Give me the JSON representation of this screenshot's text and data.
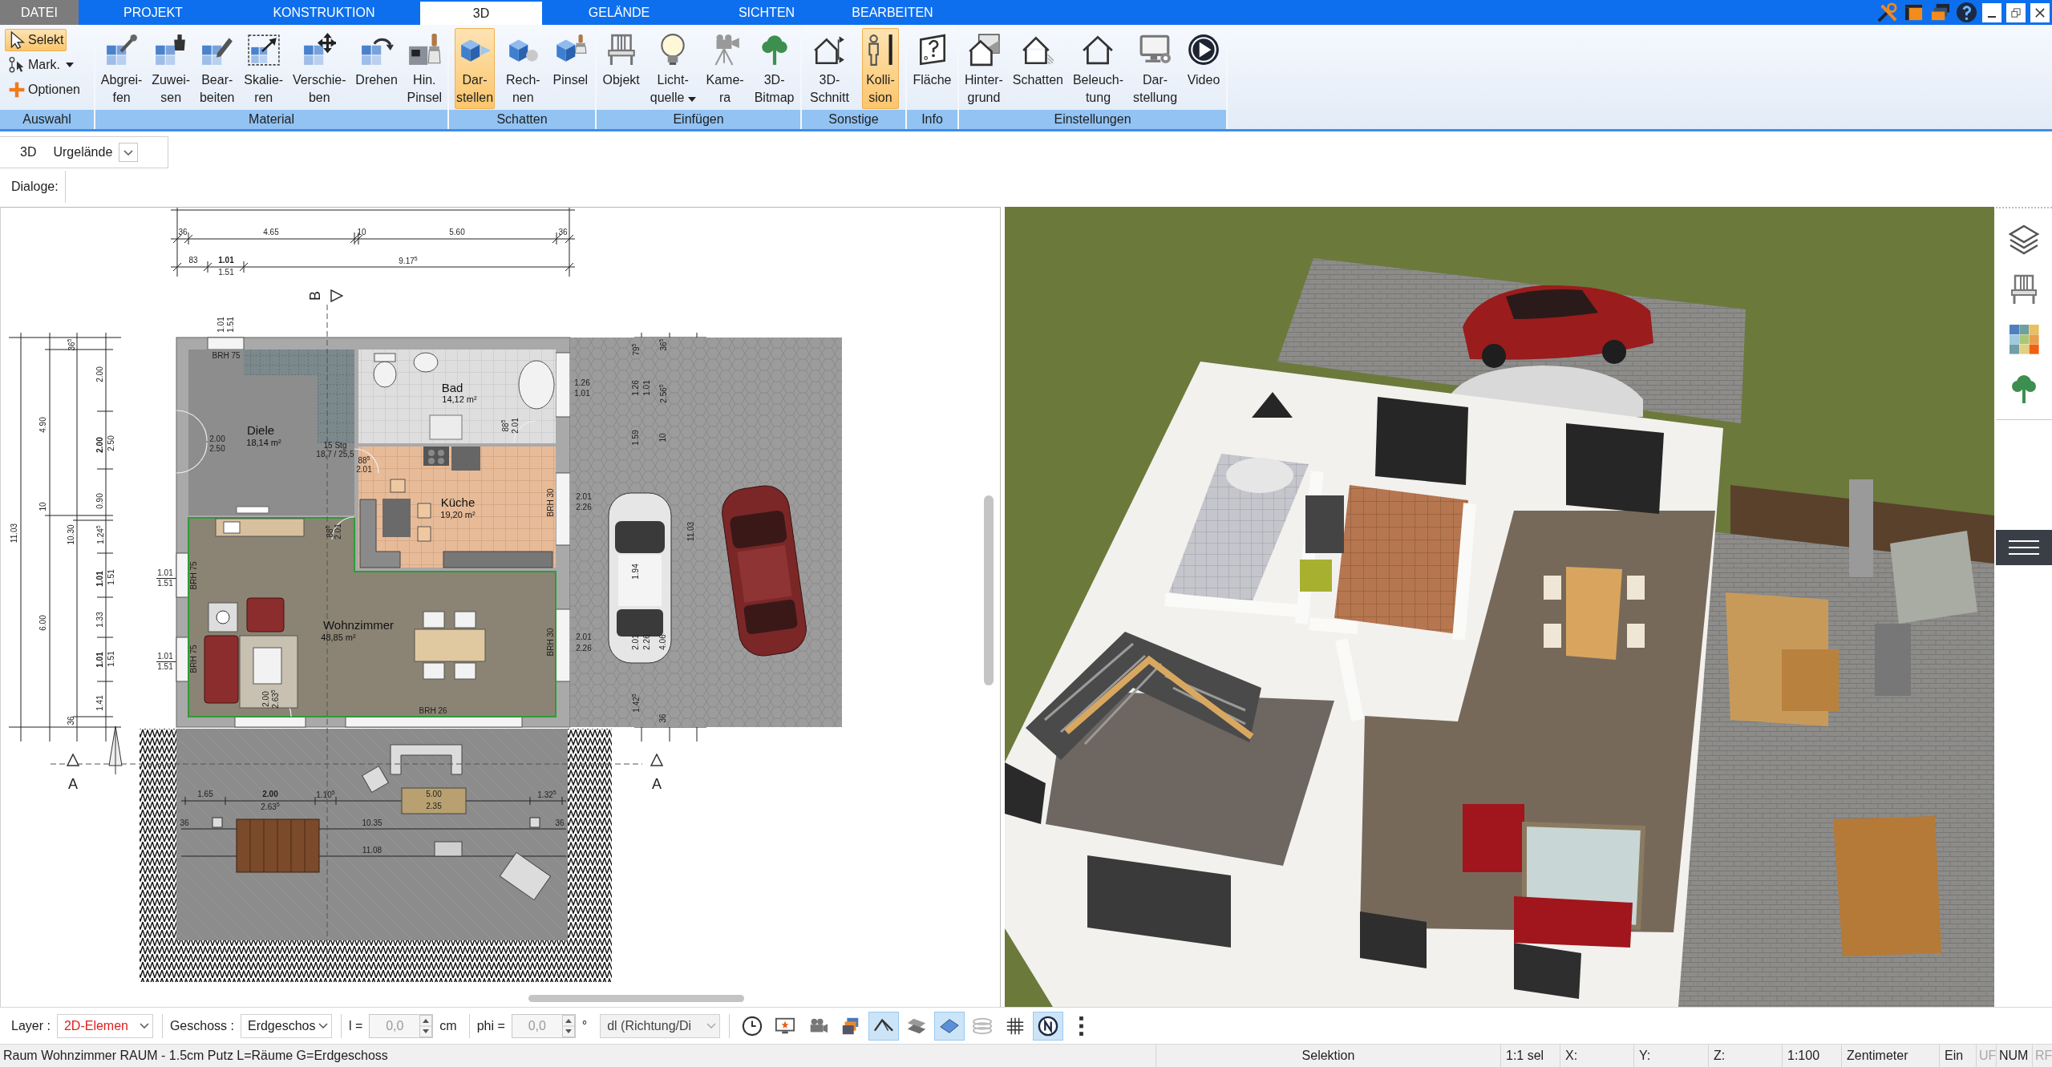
{
  "menu_tabs": [
    {
      "label": "DATEI",
      "kind": "file",
      "selected": false
    },
    {
      "label": "PROJEKT",
      "kind": "tab",
      "selected": false
    },
    {
      "label": "KONSTRUKTION",
      "kind": "tab",
      "selected": false
    },
    {
      "label": "3D",
      "kind": "tab",
      "selected": true
    },
    {
      "label": "GELÄNDE",
      "kind": "tab",
      "selected": false
    },
    {
      "label": "SICHTEN",
      "kind": "tab",
      "selected": false
    },
    {
      "label": "BEARBEITEN",
      "kind": "tab",
      "selected": false
    }
  ],
  "ribbon": {
    "groups": [
      {
        "label": "Auswahl",
        "items": [
          {
            "kind": "small",
            "lines": [
              "Selekt"
            ],
            "selected": true,
            "dropdown": false
          },
          {
            "kind": "small",
            "lines": [
              "Mark."
            ],
            "selected": false,
            "dropdown": true
          },
          {
            "kind": "small",
            "lines": [
              "Optionen"
            ],
            "selected": false,
            "dropdown": false
          }
        ]
      },
      {
        "label": "Material",
        "items": [
          {
            "kind": "large",
            "lines": [
              "Abgrei-",
              "fen"
            ],
            "selected": false,
            "dropdown": false
          },
          {
            "kind": "large",
            "lines": [
              "Zuwei-",
              "sen"
            ],
            "selected": false,
            "dropdown": false
          },
          {
            "kind": "large",
            "lines": [
              "Bear-",
              "beiten"
            ],
            "selected": false,
            "dropdown": false
          },
          {
            "kind": "large",
            "lines": [
              "Skalie-",
              "ren"
            ],
            "selected": false,
            "dropdown": false
          },
          {
            "kind": "large",
            "lines": [
              "Verschie-",
              "ben"
            ],
            "selected": false,
            "dropdown": false
          },
          {
            "kind": "large",
            "lines": [
              "Drehen"
            ],
            "selected": false,
            "dropdown": false
          },
          {
            "kind": "large",
            "lines": [
              "Hin.",
              "Pinsel"
            ],
            "selected": false,
            "dropdown": false
          }
        ]
      },
      {
        "label": "Schatten",
        "items": [
          {
            "kind": "large",
            "lines": [
              "Dar-",
              "stellen"
            ],
            "selected": true,
            "dropdown": false
          },
          {
            "kind": "large",
            "lines": [
              "Rech-",
              "nen"
            ],
            "selected": false,
            "dropdown": false
          },
          {
            "kind": "large",
            "lines": [
              "Pinsel"
            ],
            "selected": false,
            "dropdown": false
          }
        ]
      },
      {
        "label": "Einfügen",
        "items": [
          {
            "kind": "large",
            "lines": [
              "Objekt"
            ],
            "selected": false,
            "dropdown": false
          },
          {
            "kind": "large",
            "lines": [
              "Licht-",
              "quelle"
            ],
            "selected": false,
            "dropdown": true
          },
          {
            "kind": "large",
            "lines": [
              "Kame-",
              "ra"
            ],
            "selected": false,
            "dropdown": false
          },
          {
            "kind": "large",
            "lines": [
              "3D-",
              "Bitmap"
            ],
            "selected": false,
            "dropdown": false
          }
        ]
      },
      {
        "label": "Sonstige",
        "items": [
          {
            "kind": "large",
            "lines": [
              "3D-",
              "Schnitt"
            ],
            "selected": false,
            "dropdown": false
          },
          {
            "kind": "large",
            "lines": [
              "Kolli-",
              "sion"
            ],
            "selected": true,
            "dropdown": false
          }
        ]
      },
      {
        "label": "Info",
        "items": [
          {
            "kind": "large",
            "lines": [
              "Fläche"
            ],
            "selected": false,
            "dropdown": false
          }
        ]
      },
      {
        "label": "Einstellungen",
        "items": [
          {
            "kind": "large",
            "lines": [
              "Hinter-",
              "grund"
            ],
            "selected": false,
            "dropdown": false
          },
          {
            "kind": "large",
            "lines": [
              "Schatten"
            ],
            "selected": false,
            "dropdown": false
          },
          {
            "kind": "large",
            "lines": [
              "Beleuch-",
              "tung"
            ],
            "selected": false,
            "dropdown": false
          },
          {
            "kind": "large",
            "lines": [
              "Dar-",
              "stellung"
            ],
            "selected": false,
            "dropdown": false
          },
          {
            "kind": "large",
            "lines": [
              "Video"
            ],
            "selected": false,
            "dropdown": false
          }
        ]
      }
    ]
  },
  "view_bar": {
    "mode": "3D",
    "terrain": {
      "value": "Urgelände"
    }
  },
  "dialogs_bar": {
    "label": "Dialoge:"
  },
  "floor_plan": {
    "rooms": [
      {
        "name": "Diele",
        "area": "18,14 m²"
      },
      {
        "name": "Bad",
        "area": "14,12 m²"
      },
      {
        "name": "Küche",
        "area": "19,20 m²"
      },
      {
        "name": "Wohnzimmer",
        "area": "48,85 m²"
      }
    ],
    "dimension_labels": [
      "36",
      "4.65",
      "10",
      "5.60",
      "36",
      "83",
      "1.01",
      "1.51",
      "9.17$^{5}$",
      "1.01",
      "1.51",
      "11.03",
      "4.90",
      "10",
      "6.00",
      "10.30",
      "36$^{5}$",
      "36",
      "2.00",
      "2.00",
      "2.50",
      "0.90",
      "1.24$^{5}$",
      "1.01",
      "1.51",
      "1.33",
      "1.01",
      "1.51",
      "1.41",
      "1.01",
      "1.51",
      "1.01",
      "1.51",
      "2.00",
      "2.50",
      "15 Stg",
      "18,7 / 25,5",
      "88$^{5}$",
      "2.01",
      "88$^{5}$",
      "2.01",
      "88$^{5}$",
      "2.01",
      "2.00",
      "2.63$^{5}$",
      "BRH 75",
      "BRH 75",
      "BRH 75",
      "BRH 30",
      "BRH 30",
      "BRH 26",
      "1.26",
      "1.01",
      "2.01",
      "2.26",
      "2.01",
      "2.26",
      "79$^{5}$",
      "36$^{5}$",
      "1.26",
      "1.01",
      "2.56$^{5}$",
      "1.59",
      "10",
      "1.94",
      "11.03",
      "2.01",
      "2.26",
      "4.06",
      "1.42$^{5}$",
      "36",
      "1.65",
      "2.00",
      "2.63$^{5}$",
      "1.10$^{5}$",
      "5.00",
      "2.35",
      "1.32$^{5}$",
      "10.35",
      "11.08",
      "36",
      "36"
    ],
    "section_marks": [
      "B",
      "A",
      "A"
    ]
  },
  "bottom_toolbar": {
    "layer": {
      "label": "Layer :",
      "value": "2D-Elemen"
    },
    "floor": {
      "label": "Geschoss :",
      "value": "Erdgeschos"
    },
    "length": {
      "label": "l =",
      "value": "0,0",
      "unit": "cm",
      "disabled": true
    },
    "angle": {
      "label": "phi =",
      "value": "0,0",
      "unit": "°",
      "disabled": true
    },
    "direction": {
      "value": "dl (Richtung/Di",
      "disabled": true
    },
    "tools": [
      {
        "selected": false
      },
      {
        "selected": false
      },
      {
        "selected": false
      },
      {
        "selected": false
      },
      {
        "selected": true
      },
      {
        "selected": false
      },
      {
        "selected": true
      },
      {
        "selected": false
      },
      {
        "selected": false
      },
      {
        "selected": true
      },
      {
        "selected": false
      }
    ]
  },
  "status_bar": {
    "message": "Raum Wohnzimmer RAUM - 1.5cm Putz L=Räume G=Erdgeschoss",
    "panes": [
      "Selektion",
      "1:1 sel",
      "X:",
      "Y:",
      "Z:",
      "1:100",
      "Zentimeter",
      "Ein"
    ],
    "indicators": [
      {
        "label": "UF",
        "on": false
      },
      {
        "label": "NUM",
        "on": true
      },
      {
        "label": "RF",
        "on": false
      }
    ]
  }
}
